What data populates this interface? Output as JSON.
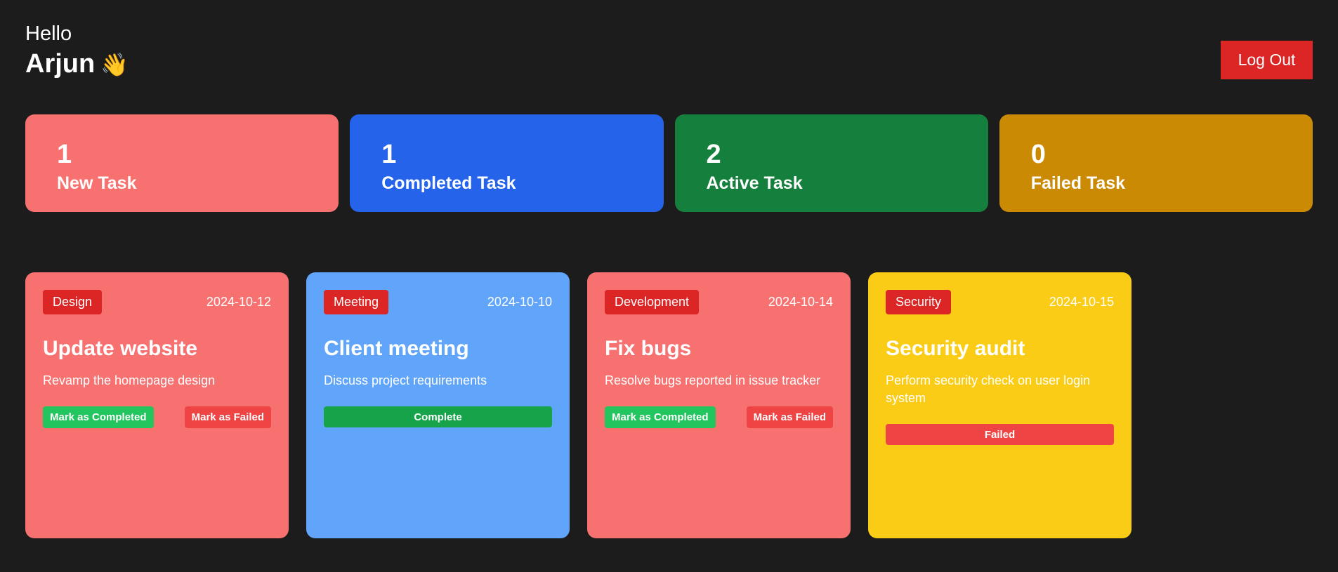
{
  "header": {
    "greeting": "Hello",
    "username": "Arjun",
    "wave_emoji": "👋",
    "logout_label": "Log Out"
  },
  "stats": [
    {
      "count": "1",
      "label": "New Task",
      "color": "#f87171"
    },
    {
      "count": "1",
      "label": "Completed Task",
      "color": "#2563eb"
    },
    {
      "count": "2",
      "label": "Active Task",
      "color": "#15803d"
    },
    {
      "count": "0",
      "label": "Failed Task",
      "color": "#ca8a04"
    }
  ],
  "tasks": [
    {
      "category": "Design",
      "date": "2024-10-12",
      "title": "Update website",
      "description": "Revamp the homepage design",
      "complete_label": "Mark as Completed",
      "fail_label": "Mark as Failed",
      "color": "#f87171"
    },
    {
      "category": "Meeting",
      "date": "2024-10-10",
      "title": "Client meeting",
      "description": "Discuss project requirements",
      "status_label": "Complete",
      "color": "#60a5fa"
    },
    {
      "category": "Development",
      "date": "2024-10-14",
      "title": "Fix bugs",
      "description": "Resolve bugs reported in issue tracker",
      "complete_label": "Mark as Completed",
      "fail_label": "Mark as Failed",
      "color": "#f87171"
    },
    {
      "category": "Security",
      "date": "2024-10-15",
      "title": "Security audit",
      "description": "Perform security check on user login system",
      "status_label": "Failed",
      "color": "#facc15"
    }
  ]
}
